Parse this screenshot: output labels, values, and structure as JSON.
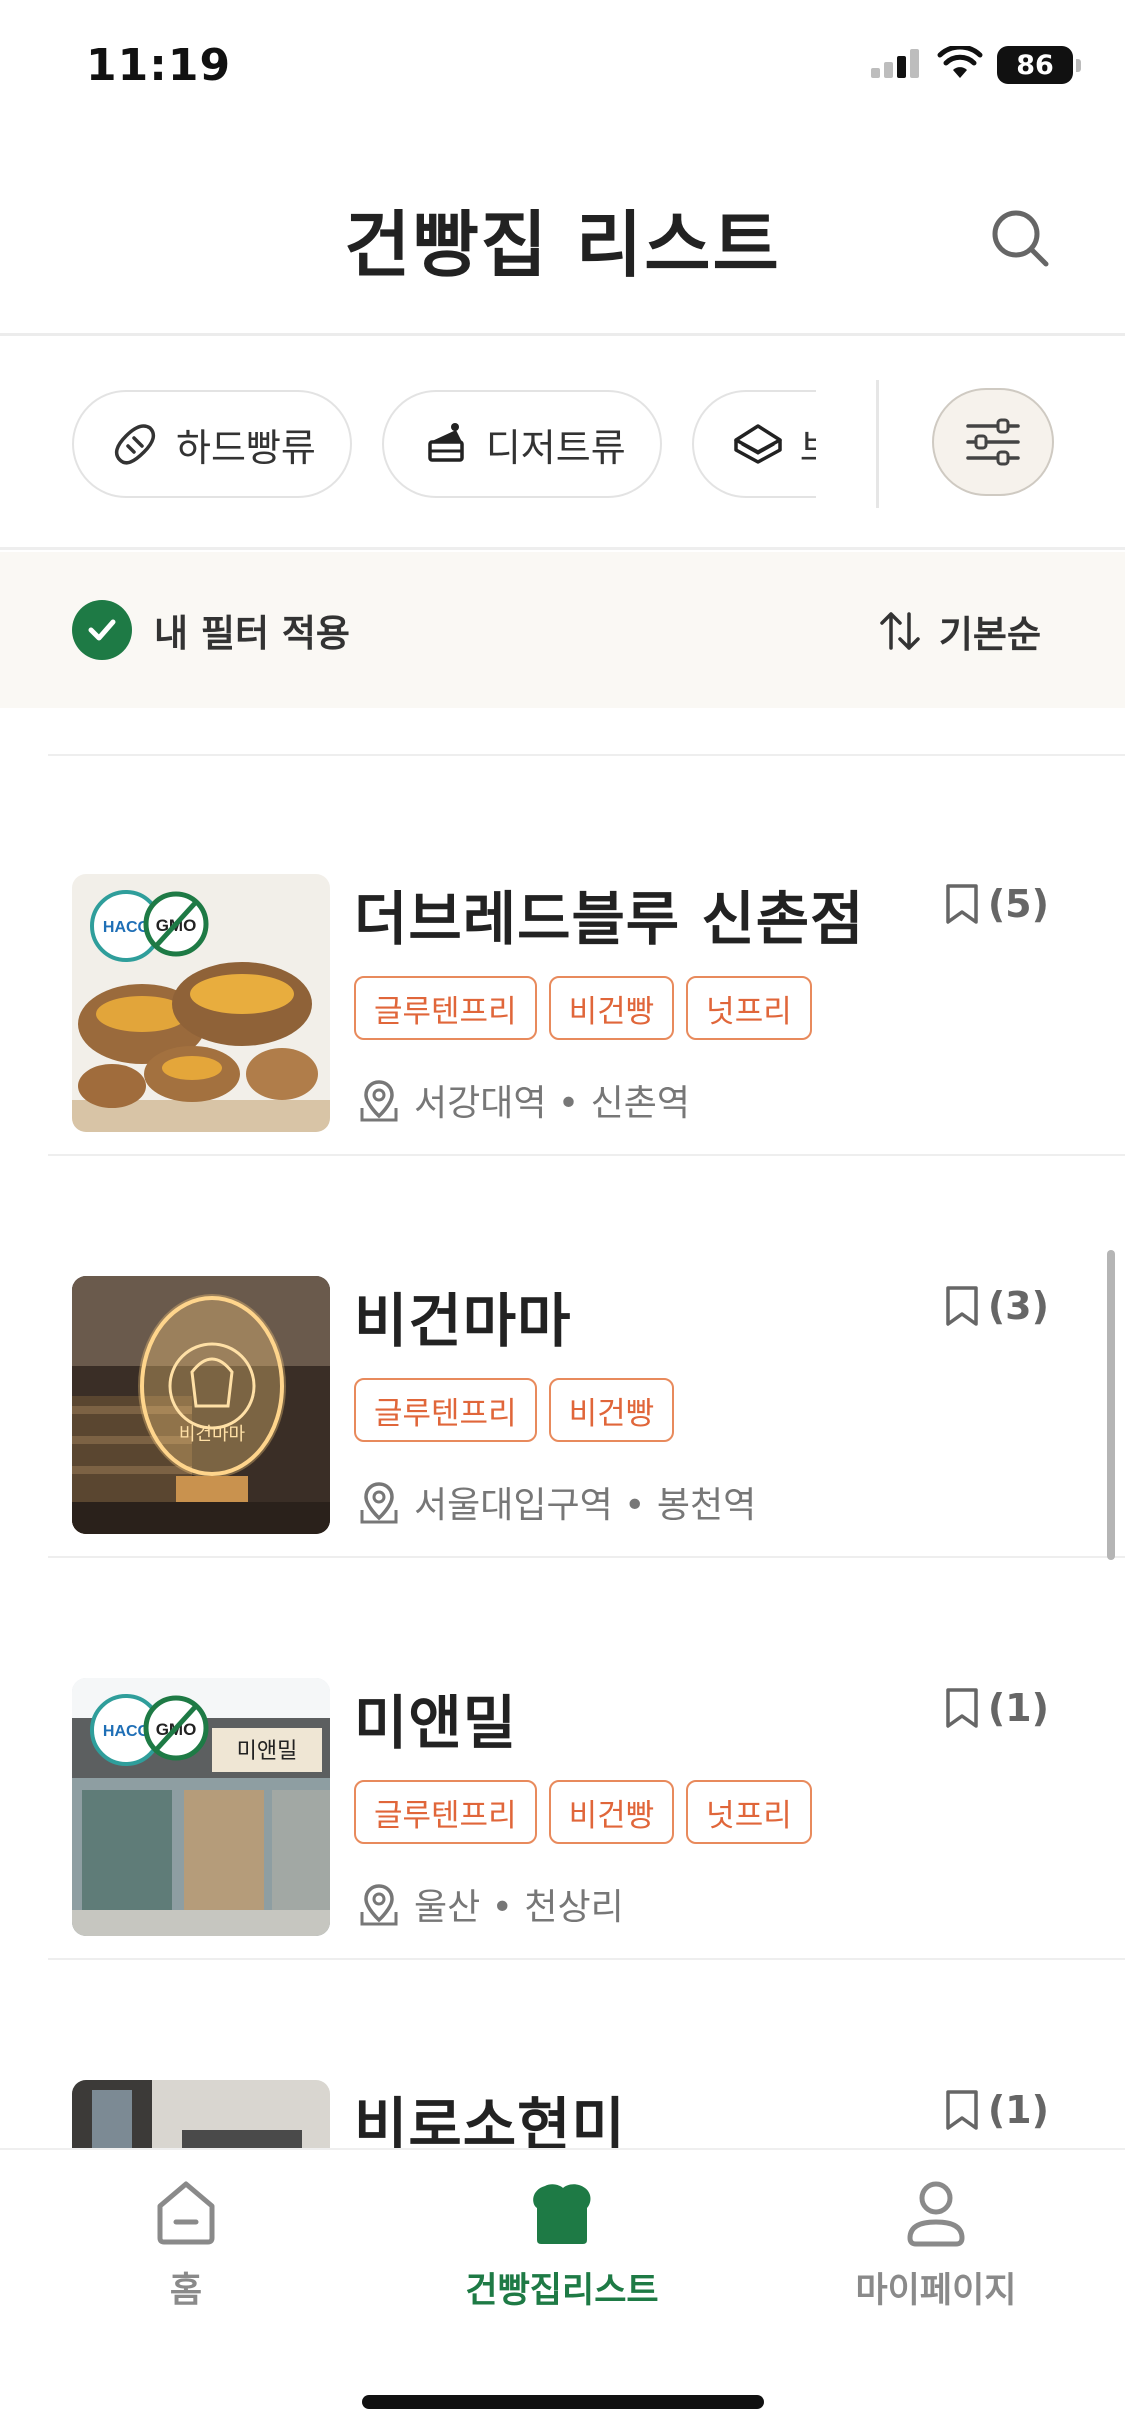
{
  "status": {
    "time": "11:19",
    "battery": "86"
  },
  "header": {
    "title": "건빵집 리스트",
    "search_icon": "search-icon"
  },
  "categories": [
    {
      "label": "하드빵류",
      "icon": "baguette-icon"
    },
    {
      "label": "디저트류",
      "icon": "cake-icon"
    },
    {
      "label": "브",
      "icon": "sandwich-icon"
    }
  ],
  "filter_bar": {
    "my_filter_label": "내 필터 적용",
    "sort_label": "기본순"
  },
  "shops": [
    {
      "name": "더브레드블루 신촌점",
      "bookmark_count": "(5)",
      "tags": [
        "글루텐프리",
        "비건빵",
        "넛프리"
      ],
      "location": "서강대역 • 신촌역"
    },
    {
      "name": "비건마마",
      "bookmark_count": "(3)",
      "tags": [
        "글루텐프리",
        "비건빵"
      ],
      "location": "서울대입구역 • 봉천역"
    },
    {
      "name": "미앤밀",
      "bookmark_count": "(1)",
      "tags": [
        "글루텐프리",
        "비건빵",
        "넛프리"
      ],
      "location": "울산 • 천상리"
    },
    {
      "name": "비로소현미",
      "bookmark_count": "(1)",
      "tags": [
        "",
        "",
        ""
      ],
      "location": ""
    }
  ],
  "tabs": [
    {
      "label": "홈",
      "icon": "home-icon"
    },
    {
      "label": "건빵집리스트",
      "icon": "bread-icon",
      "active": true
    },
    {
      "label": "마이페이지",
      "icon": "person-icon"
    }
  ],
  "colors": {
    "brand_green": "#1e7a45",
    "tag_orange": "#e0663a",
    "filter_bg": "#faf8f4"
  }
}
